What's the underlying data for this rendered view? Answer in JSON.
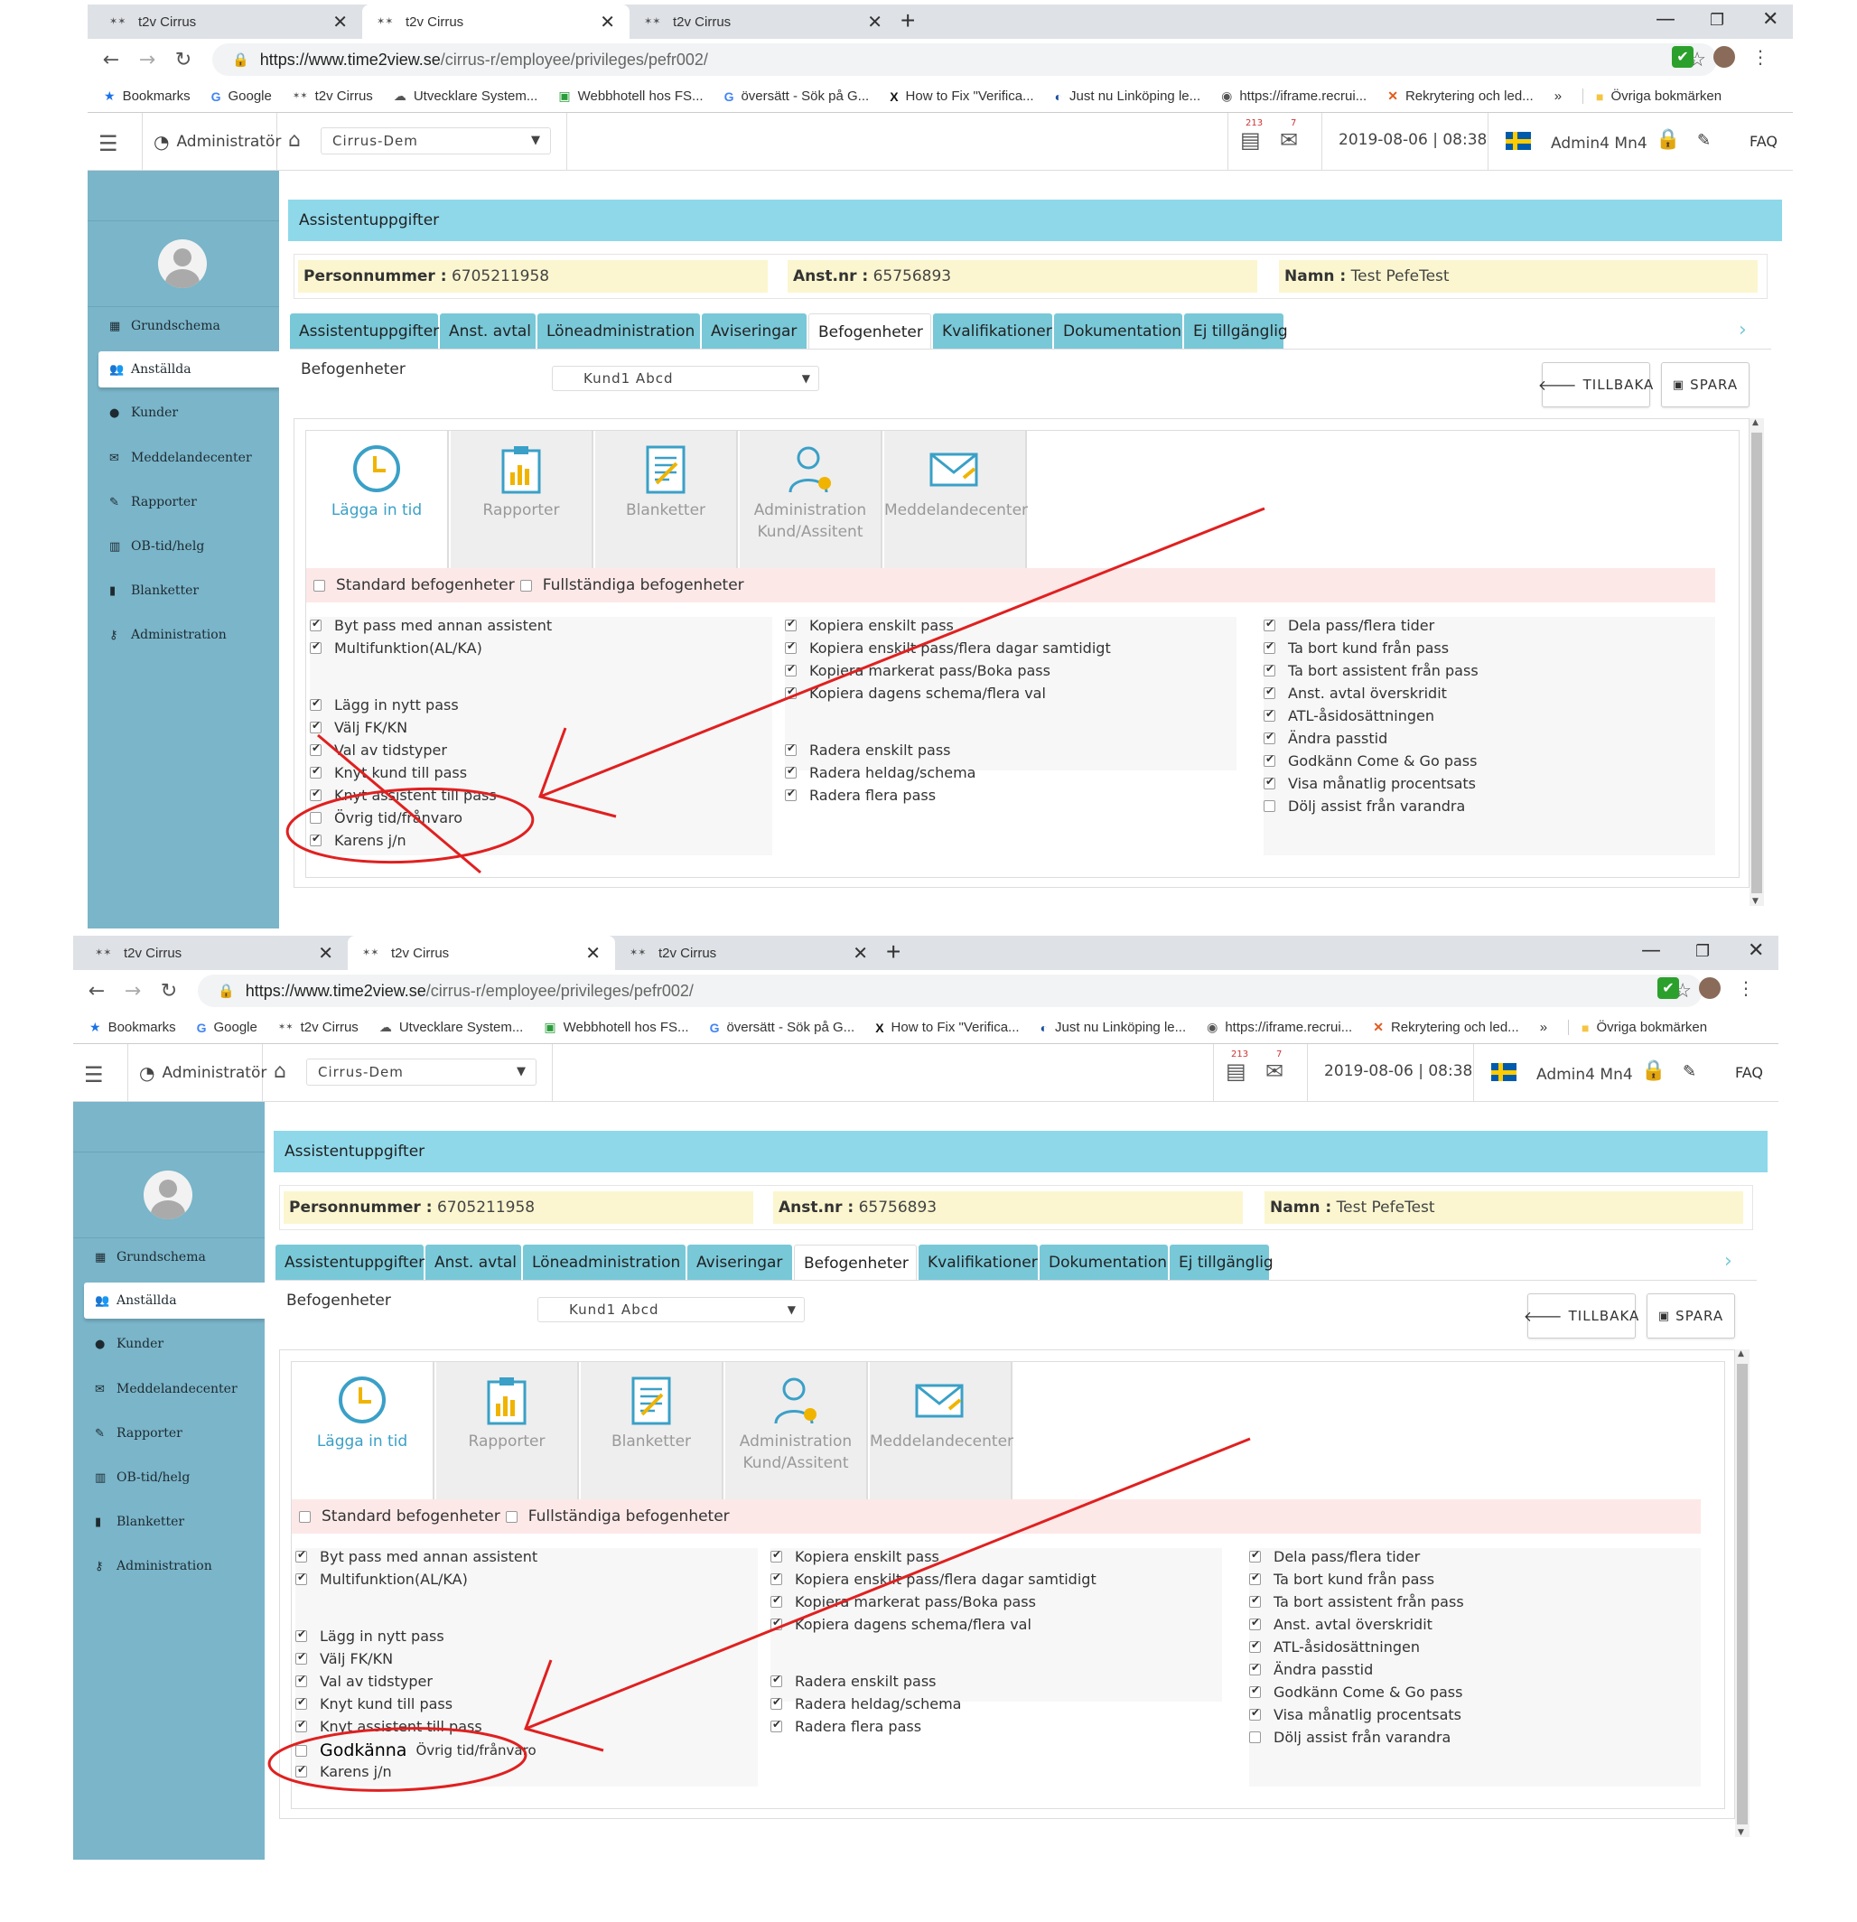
{
  "browser": {
    "tabs": [
      "t2v Cirrus",
      "t2v Cirrus",
      "t2v Cirrus"
    ],
    "url_host": "https://www.time2view.se",
    "url_path": "/cirrus-r/employee/privileges/pefr002/",
    "bookmarks": [
      "Bookmarks",
      "Google",
      "t2v Cirrus",
      "Utvecklare System...",
      "Webbhotell hos FS...",
      "översätt - Sök på G...",
      "How to Fix \"Verifica...",
      "Just nu Linköping le...",
      "https://iframe.recrui...",
      "Rekrytering och led..."
    ],
    "bookmarks_more": "»",
    "other_bookmarks": "Övriga bokmärken"
  },
  "topnav": {
    "role": "Administratör",
    "org_select": "Cirrus-Dem",
    "badge_1": "213",
    "badge_2": "7",
    "datetime": "2019-08-06 | 08:38",
    "user": "Admin4 Mn4",
    "faq": "FAQ"
  },
  "sidebar": {
    "items": [
      "Grundschema",
      "Anställda",
      "Kunder",
      "Meddelandecenter",
      "Rapporter",
      "OB-tid/helg",
      "Blanketter",
      "Administration"
    ],
    "active": "Anställda"
  },
  "page": {
    "title": "Assistentuppgifter",
    "personnummer_label": "Personnummer :",
    "personnummer": "6705211958",
    "anstnr_label": "Anst.nr :",
    "anstnr": "65756893",
    "namn_label": "Namn :",
    "namn": "Test PefeTest",
    "tabs": [
      "Assistentuppgifter",
      "Anst. avtal",
      "Löneadministration",
      "Aviseringar",
      "Befogenheter",
      "Kvalifikationer",
      "Dokumentation",
      "Ej tillgänglig"
    ],
    "active_tab": "Befogenheter",
    "section_label": "Befogenheter",
    "kund_select": "Kund1 Abcd",
    "back_button": "TILLBAKA",
    "save_button": "SPARA"
  },
  "modules": [
    {
      "line1": "Lägga in tid",
      "line2": ""
    },
    {
      "line1": "Rapporter",
      "line2": ""
    },
    {
      "line1": "Blanketter",
      "line2": ""
    },
    {
      "line1": "Administration",
      "line2": "Kund/Assitent"
    },
    {
      "line1": "Meddelandecenter",
      "line2": ""
    }
  ],
  "standard": {
    "std": "Standard befogenheter",
    "full": "Fullständiga befogenheter"
  },
  "col1": [
    {
      "label": "Byt pass med annan assistent",
      "checked": true
    },
    {
      "label": "Multifunktion(AL/KA)",
      "checked": true
    },
    {
      "label": "Lägg in nytt pass",
      "checked": true
    },
    {
      "label": "Välj FK/KN",
      "checked": true
    },
    {
      "label": "Val av tidstyper",
      "checked": true
    },
    {
      "label": "Knyt kund till pass",
      "checked": true
    },
    {
      "label": "Knyt assistent till pass",
      "checked": true
    },
    {
      "label": "Övrig tid/frånvaro",
      "checked": false
    },
    {
      "label": "Karens j/n",
      "checked": true
    }
  ],
  "col2": [
    {
      "label": "Kopiera enskilt pass",
      "checked": true
    },
    {
      "label": "Kopiera enskilt pass/flera dagar samtidigt",
      "checked": true
    },
    {
      "label": "Kopiera markerat pass/Boka pass",
      "checked": true
    },
    {
      "label": "Kopiera dagens schema/flera val",
      "checked": true
    },
    {
      "label": "Radera enskilt pass",
      "checked": true
    },
    {
      "label": "Radera heldag/schema",
      "checked": true
    },
    {
      "label": "Radera flera pass",
      "checked": true
    }
  ],
  "col3": [
    {
      "label": "Dela pass/flera tider",
      "checked": true
    },
    {
      "label": "Ta bort kund från pass",
      "checked": true
    },
    {
      "label": "Ta bort assistent från pass",
      "checked": true
    },
    {
      "label": "Anst. avtal överskridit",
      "checked": true
    },
    {
      "label": "ATL-åsidosättningen",
      "checked": true
    },
    {
      "label": "Ändra passtid",
      "checked": true
    },
    {
      "label": "Godkänn Come & Go pass",
      "checked": true
    },
    {
      "label": "Visa månatlig procentsats",
      "checked": true
    },
    {
      "label": "Dölj assist från varandra",
      "checked": false
    }
  ],
  "annotation": {
    "godkanna": "Godkänna"
  },
  "colors": {
    "sidebar": "#7ab5c9",
    "title_bar": "#8ed8ea",
    "tab": "#78c8d8",
    "info_bg": "#fbf6cf",
    "std_row": "#fde8e8",
    "annotation_red": "#e02020"
  }
}
